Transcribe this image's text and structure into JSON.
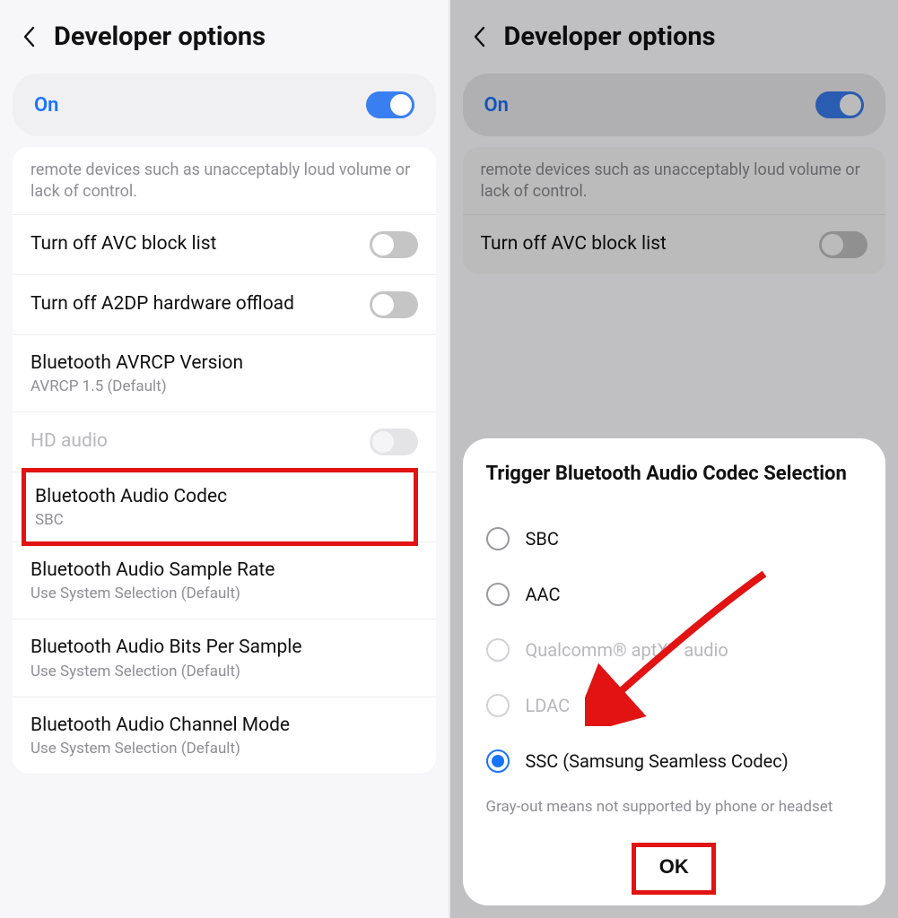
{
  "left": {
    "header": {
      "title": "Developer options"
    },
    "onbar": {
      "label": "On",
      "toggled": true
    },
    "note": "remote devices such as unacceptably loud volume or lack of control.",
    "rows": {
      "avc": {
        "title": "Turn off AVC block list"
      },
      "a2dp": {
        "title": "Turn off A2DP hardware offload"
      },
      "avrcp": {
        "title": "Bluetooth AVRCP Version",
        "sub": "AVRCP 1.5 (Default)"
      },
      "hd": {
        "title": "HD audio"
      },
      "codec": {
        "title": "Bluetooth Audio Codec",
        "sub": "SBC"
      },
      "sample": {
        "title": "Bluetooth Audio Sample Rate",
        "sub": "Use System Selection (Default)"
      },
      "bits": {
        "title": "Bluetooth Audio Bits Per Sample",
        "sub": "Use System Selection (Default)"
      },
      "channel": {
        "title": "Bluetooth Audio Channel Mode",
        "sub": "Use System Selection (Default)"
      }
    }
  },
  "right": {
    "header": {
      "title": "Developer options"
    },
    "onbar": {
      "label": "On",
      "toggled": true
    },
    "note": "remote devices such as unacceptably loud volume or lack of control.",
    "rows": {
      "avc": {
        "title": "Turn off AVC block list"
      }
    },
    "dialog": {
      "title": "Trigger Bluetooth Audio Codec Selection",
      "options": {
        "sbc": "SBC",
        "aac": "AAC",
        "aptx": "Qualcomm® aptX™ audio",
        "ldac": "LDAC",
        "ssc": "SSC (Samsung Seamless Codec)"
      },
      "note": "Gray-out means not supported by phone or headset",
      "ok": "OK"
    }
  }
}
